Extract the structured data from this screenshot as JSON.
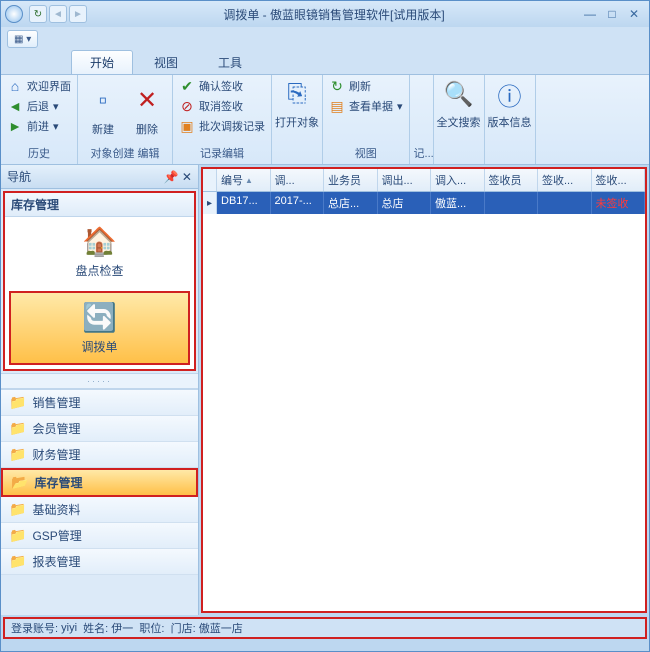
{
  "title": "调拨单 - 傲蓝眼镜销售管理软件[试用版本]",
  "tabs": {
    "start": "开始",
    "view": "视图",
    "tools": "工具"
  },
  "ribbon": {
    "history": {
      "welcome": "欢迎界面",
      "back": "后退",
      "forward": "前进",
      "cap": "历史"
    },
    "create": {
      "new": "新建",
      "delete": "删除",
      "cap_create": "对象创建",
      "cap_edit": "编辑"
    },
    "record": {
      "confirm": "确认签收",
      "cancel": "取消签收",
      "batch": "批次调拨记录",
      "cap": "记录编辑"
    },
    "open": {
      "label": "打开对象"
    },
    "viewgrp": {
      "refresh": "刷新",
      "sheet": "查看单据",
      "cap": "视图"
    },
    "rec": {
      "cap": "记..."
    },
    "search": {
      "label": "全文搜索"
    },
    "version": {
      "label": "版本信息"
    }
  },
  "sidebar": {
    "title": "导航",
    "section": "库存管理",
    "items": {
      "check": "盘点检查",
      "transfer": "调拨单"
    },
    "cats": [
      "销售管理",
      "会员管理",
      "财务管理",
      "库存管理",
      "基础资料",
      "GSP管理",
      "报表管理"
    ]
  },
  "grid": {
    "headers": [
      "编号",
      "调...",
      "业务员",
      "调出...",
      "调入...",
      "签收员",
      "签收...",
      "签收..."
    ],
    "row": [
      "DB17...",
      "2017-...",
      "总店...",
      "总店",
      "傲蓝...",
      "",
      "",
      "未签收"
    ]
  },
  "status": {
    "account_l": "登录账号:",
    "account_v": "yiyi",
    "name_l": "姓名:",
    "name_v": "伊一",
    "pos_l": "职位:",
    "store_l": "门店:",
    "store_v": "傲蓝一店"
  }
}
